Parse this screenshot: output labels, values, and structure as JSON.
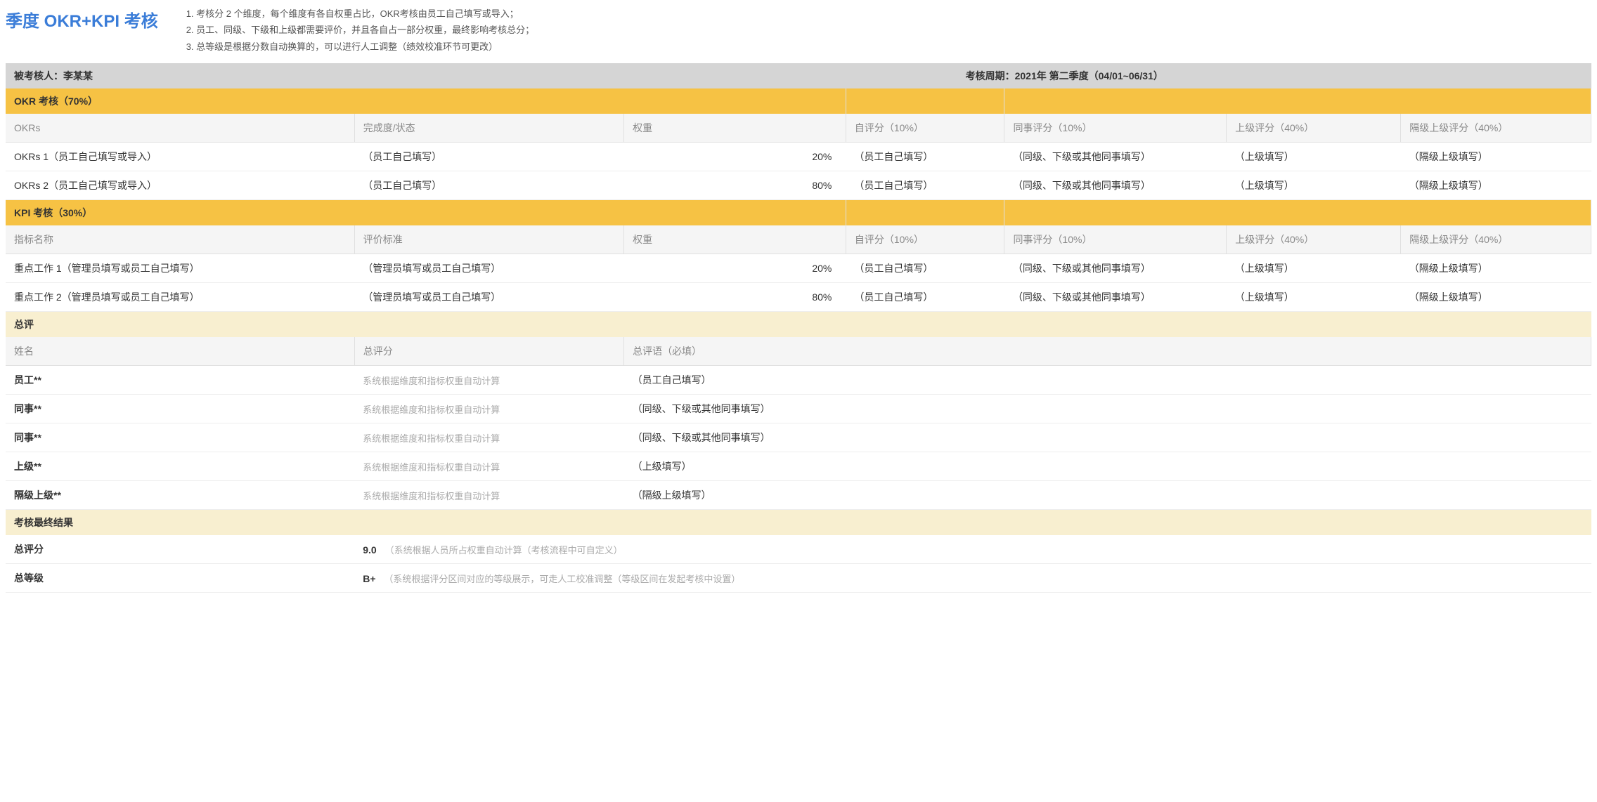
{
  "header": {
    "title": "季度 OKR+KPI 考核",
    "notes": [
      "1.   考核分 2 个维度，每个维度有各自权重占比，OKR考核由员工自己填写或导入；",
      "2.   员工、同级、下级和上级都需要评价，并且各自占一部分权重，最终影响考核总分；",
      "3.   总等级是根据分数自动换算的，可以进行人工调整（绩效校准环节可更改）"
    ]
  },
  "info": {
    "person_label": "被考核人：李某某",
    "period_label": "考核周期：2021年 第二季度（04/01~06/31）"
  },
  "okr": {
    "section_title": "OKR 考核（70%）",
    "headers": [
      "OKRs",
      "完成度/状态",
      "权重",
      "自评分（10%）",
      "同事评分（10%）",
      "上级评分（40%）",
      "隔级上级评分（40%）"
    ],
    "rows": [
      {
        "name": "OKRs 1（员工自己填写或导入）",
        "status": "（员工自己填写）",
        "weight": "20%",
        "self": "（员工自己填写）",
        "peer": "（同级、下级或其他同事填写）",
        "sup": "（上级填写）",
        "skip": "（隔级上级填写）"
      },
      {
        "name": "OKRs 2（员工自己填写或导入）",
        "status": "（员工自己填写）",
        "weight": "80%",
        "self": "（员工自己填写）",
        "peer": "（同级、下级或其他同事填写）",
        "sup": "（上级填写）",
        "skip": "（隔级上级填写）"
      }
    ]
  },
  "kpi": {
    "section_title": "KPI 考核（30%）",
    "headers": [
      "指标名称",
      "评价标准",
      "权重",
      "自评分（10%）",
      "同事评分（10%）",
      "上级评分（40%）",
      "隔级上级评分（40%）"
    ],
    "rows": [
      {
        "name": "重点工作 1（管理员填写或员工自己填写）",
        "status": "（管理员填写或员工自己填写）",
        "weight": "20%",
        "self": "（员工自己填写）",
        "peer": "（同级、下级或其他同事填写）",
        "sup": "（上级填写）",
        "skip": "（隔级上级填写）"
      },
      {
        "name": "重点工作 2（管理员填写或员工自己填写）",
        "status": "（管理员填写或员工自己填写）",
        "weight": "80%",
        "self": "（员工自己填写）",
        "peer": "（同级、下级或其他同事填写）",
        "sup": "（上级填写）",
        "skip": "（隔级上级填写）"
      }
    ]
  },
  "summary": {
    "section_title": "总评",
    "headers": [
      "姓名",
      "总评分",
      "总评语（必填）"
    ],
    "rows": [
      {
        "name": "员工**",
        "score": "系统根据维度和指标权重自动计算",
        "comment": "（员工自己填写）"
      },
      {
        "name": "同事**",
        "score": "系统根据维度和指标权重自动计算",
        "comment": "（同级、下级或其他同事填写）"
      },
      {
        "name": "同事**",
        "score": "系统根据维度和指标权重自动计算",
        "comment": "（同级、下级或其他同事填写）"
      },
      {
        "name": "上级**",
        "score": "系统根据维度和指标权重自动计算",
        "comment": "（上级填写）"
      },
      {
        "name": "隔级上级**",
        "score": "系统根据维度和指标权重自动计算",
        "comment": "（隔级上级填写）"
      }
    ]
  },
  "final": {
    "section_title": "考核最终结果",
    "rows": [
      {
        "label": "总评分",
        "value": "9.0",
        "hint": "（系统根据人员所占权重自动计算（考核流程中可自定义）"
      },
      {
        "label": "总等级",
        "value": "B+",
        "hint": "（系统根据评分区间对应的等级展示，可走人工校准调整（等级区间在发起考核中设置）"
      }
    ]
  }
}
